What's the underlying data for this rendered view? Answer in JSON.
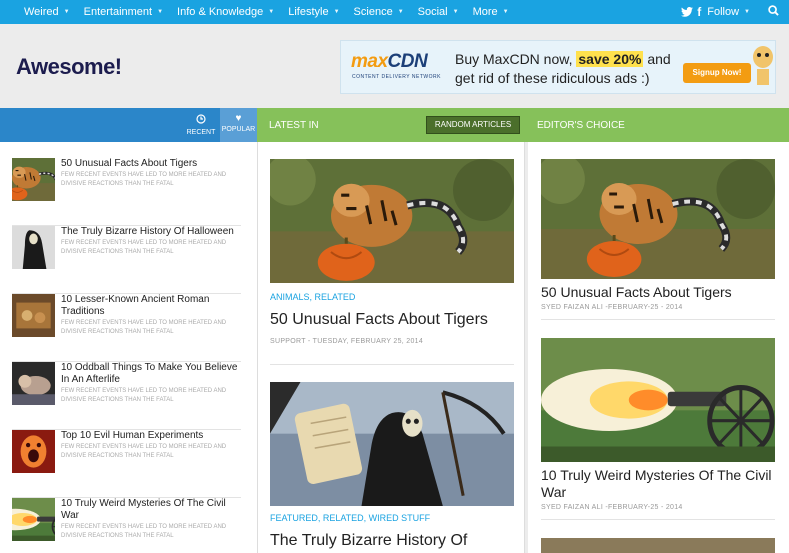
{
  "nav": {
    "items": [
      "Weired",
      "Entertainment",
      "Info & Knowledge",
      "Lifestyle",
      "Science",
      "Social",
      "More"
    ],
    "follow_label": "Follow",
    "icons": [
      "twitter-icon",
      "facebook-icon",
      "search-icon"
    ]
  },
  "header": {
    "logo": "Awesome!"
  },
  "ad": {
    "brand_a": "max",
    "brand_b": "CDN",
    "brand_sub": "CONTENT DELIVERY NETWORK",
    "line1_a": "Buy MaxCDN now, ",
    "line1_hl": "save 20%",
    "line1_b": " and",
    "line2": "get rid of these ridiculous ads :)",
    "button": "Signup Now!"
  },
  "tabs": {
    "recent": "RECENT",
    "popular": "POPULAR",
    "latest": "LATEST IN",
    "random": "RANDOM ARTICLES",
    "editors": "EDITOR'S CHOICE"
  },
  "sidebar": {
    "excerpt": "FEW RECENT EVENTS HAVE LED TO MORE HEATED AND DIVISIVE REACTIONS THAN THE FATAL",
    "items": [
      {
        "title": "50 Unusual Facts About Tigers"
      },
      {
        "title": "The Truly Bizarre History Of Halloween"
      },
      {
        "title": "10 Lesser-Known Ancient Roman Traditions"
      },
      {
        "title": "10 Oddball Things To Make You Believe In An Afterlife"
      },
      {
        "title": "Top 10 Evil Human Experiments"
      },
      {
        "title": "10 Truly Weird Mysteries Of The Civil War"
      }
    ]
  },
  "main": {
    "cards": [
      {
        "categories": "ANIMALS, RELATED",
        "title": "50 Unusual Facts About Tigers",
        "meta": "SUPPORT - TUESDAY, FEBRUARY 25, 2014"
      },
      {
        "categories": "FEATURED, RELATED, WIRED STUFF",
        "title": "The Truly Bizarre History Of"
      }
    ]
  },
  "editors": {
    "cards": [
      {
        "title": "50 Unusual Facts About Tigers",
        "meta": "SYED FAIZAN ALI -FEBRUARY-25 - 2014"
      },
      {
        "title": "10 Truly Weird Mysteries Of The Civil War",
        "meta": "SYED FAIZAN ALI -FEBRUARY-25 - 2014"
      }
    ]
  },
  "colors": {
    "nav_bg": "#1aa3e1",
    "left_bar": "#2b86c9",
    "green_bar": "#86c15a",
    "link": "#1aa3e1"
  }
}
